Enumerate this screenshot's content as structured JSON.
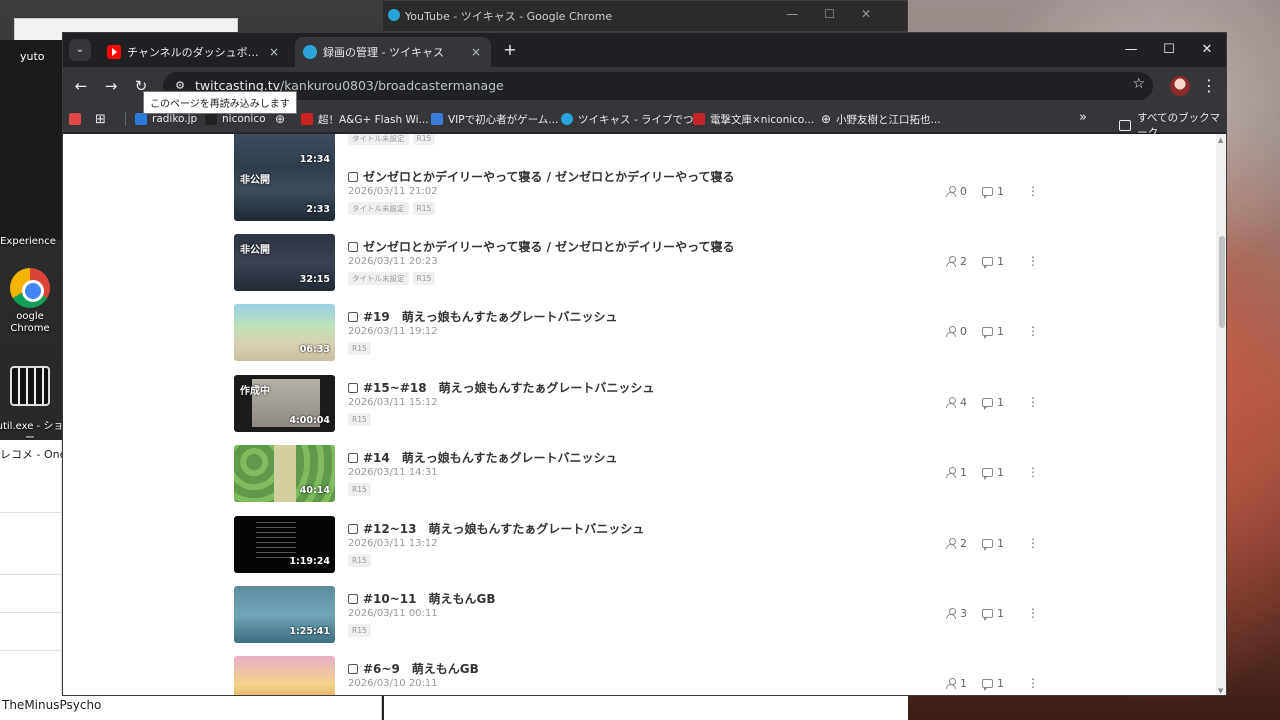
{
  "desktop": {
    "icons": [
      {
        "label": "Experience"
      },
      {
        "label": "oogle Chrome"
      },
      {
        "label": "util.exe - ショー\nカット"
      }
    ],
    "left_window_label": "yuto",
    "left_window_text": "レコメ - One",
    "bottom_left_text": "TheMinusPsycho"
  },
  "background_window": {
    "title": "YouTube - ツイキャス - Google Chrome"
  },
  "browser": {
    "tabs": [
      {
        "label": "チャンネルのダッシュボード - YouTube",
        "close": "×"
      },
      {
        "label": "録画の管理 - ツイキャス",
        "close": "×"
      }
    ],
    "new_tab": "+",
    "window_controls": {
      "minimize": "—",
      "maximize": "☐",
      "close": "✕"
    },
    "nav": {
      "back": "←",
      "forward": "→",
      "reload": "↻"
    },
    "url_host": "twitcasting.tv",
    "url_path": "/kankurou0803/broadcastermanage",
    "tooltip": "このページを再読み込みします",
    "bookmarks": [
      {
        "label": "radiko.jp",
        "color": "#2b7bd6"
      },
      {
        "label": "niconico",
        "color": "#222222"
      },
      {
        "label": "",
        "color": "#e8eaed"
      },
      {
        "label": "超！A&G+ Flash Wi...",
        "color": "#cc2222"
      },
      {
        "label": "VIPで初心者がゲーム...",
        "color": "#3b7bd8"
      },
      {
        "label": "ツイキャス - ライブでつ...",
        "color": "#2aa4d8"
      },
      {
        "label": "電撃文庫×niconico...",
        "color": "#c4252c"
      },
      {
        "label": "小野友樹と江口拓也...",
        "color": "#e8eaed"
      }
    ],
    "bookmarks_more": "»",
    "all_bookmarks": "すべてのブックマーク"
  },
  "recordings": {
    "partial_top": {
      "duration": "12:34",
      "tags": [
        "タイトル未設定",
        "R15"
      ]
    },
    "items": [
      {
        "badge": "非公開",
        "duration": "2:33",
        "title": "ゼンゼロとかデイリーやって寝る / ゼンゼロとかデイリーやって寝る",
        "date": "2026/03/11 21:02",
        "tags": [
          "タイトル未設定",
          "R15"
        ],
        "views": "0",
        "comments": "1"
      },
      {
        "badge": "非公開",
        "duration": "32:15",
        "title": "ゼンゼロとかデイリーやって寝る / ゼンゼロとかデイリーやって寝る",
        "date": "2026/03/11 20:23",
        "tags": [
          "タイトル未設定",
          "R15"
        ],
        "views": "2",
        "comments": "1"
      },
      {
        "badge": "",
        "duration": "06:33",
        "title": "#19　萌えっ娘もんすたぁグレートバニッシュ",
        "date": "2026/03/11 19:12",
        "tags": [
          "R15"
        ],
        "views": "0",
        "comments": "1"
      },
      {
        "badge": "作成中",
        "duration": "4:00:04",
        "title": "#15~#18　萌えっ娘もんすたぁグレートバニッシュ",
        "date": "2026/03/11 15:12",
        "tags": [
          "R15"
        ],
        "views": "4",
        "comments": "1"
      },
      {
        "badge": "",
        "duration": "40:14",
        "title": "#14　萌えっ娘もんすたぁグレートバニッシュ",
        "date": "2026/03/11 14:31",
        "tags": [
          "R15"
        ],
        "views": "1",
        "comments": "1"
      },
      {
        "badge": "",
        "duration": "1:19:24",
        "title": "#12~13　萌えっ娘もんすたぁグレートバニッシュ",
        "date": "2026/03/11 13:12",
        "tags": [
          "R15"
        ],
        "views": "2",
        "comments": "1"
      },
      {
        "badge": "",
        "duration": "1:25:41",
        "title": "#10~11　萌えもんGB",
        "date": "2026/03/11 00:11",
        "tags": [
          "R15"
        ],
        "views": "3",
        "comments": "1"
      },
      {
        "badge": "",
        "duration": "",
        "title": "#6~9　萌えもんGB",
        "date": "2026/03/10 20:11",
        "tags": [],
        "views": "1",
        "comments": "1"
      }
    ],
    "more_icon": "⋮"
  }
}
